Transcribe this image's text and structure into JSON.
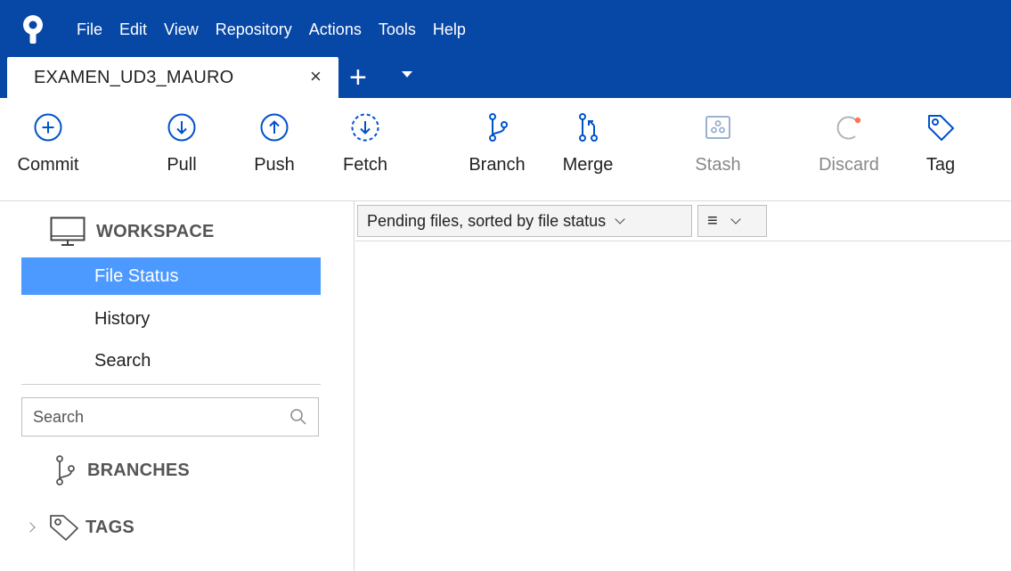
{
  "menu": [
    "File",
    "Edit",
    "View",
    "Repository",
    "Actions",
    "Tools",
    "Help"
  ],
  "tabs": {
    "active_repo": "EXAMEN_UD3_MAURO",
    "close_glyph": "×",
    "add_glyph": "+"
  },
  "toolbar": {
    "commit": "Commit",
    "pull": "Pull",
    "push": "Push",
    "fetch": "Fetch",
    "branch": "Branch",
    "merge": "Merge",
    "stash": "Stash",
    "discard": "Discard",
    "tag": "Tag"
  },
  "sidebar": {
    "workspace_header": "WORKSPACE",
    "items": [
      "File Status",
      "History",
      "Search"
    ],
    "active_item": "File Status",
    "search_placeholder": "Search",
    "branches_header": "BRANCHES",
    "tags_header": "TAGS"
  },
  "main": {
    "sort_dropdown": "Pending files, sorted by file status",
    "view_dropdown_glyph": "≡"
  },
  "colors": {
    "titlebar": "#0747a6",
    "accent": "#4c9aff",
    "icon_blue": "#0052cc",
    "discard_dot": "#ff7452"
  },
  "icons": {
    "app": "sourcetree-logo-icon",
    "commit": "plus-circle-icon",
    "pull": "arrow-down-circle-icon",
    "push": "arrow-up-circle-icon",
    "fetch": "dashed-arrow-down-circle-icon",
    "branch": "branch-icon",
    "merge": "merge-icon",
    "stash": "stash-icon",
    "discard": "discard-icon",
    "tag": "tag-icon",
    "workspace": "monitor-icon",
    "search": "search-icon"
  }
}
